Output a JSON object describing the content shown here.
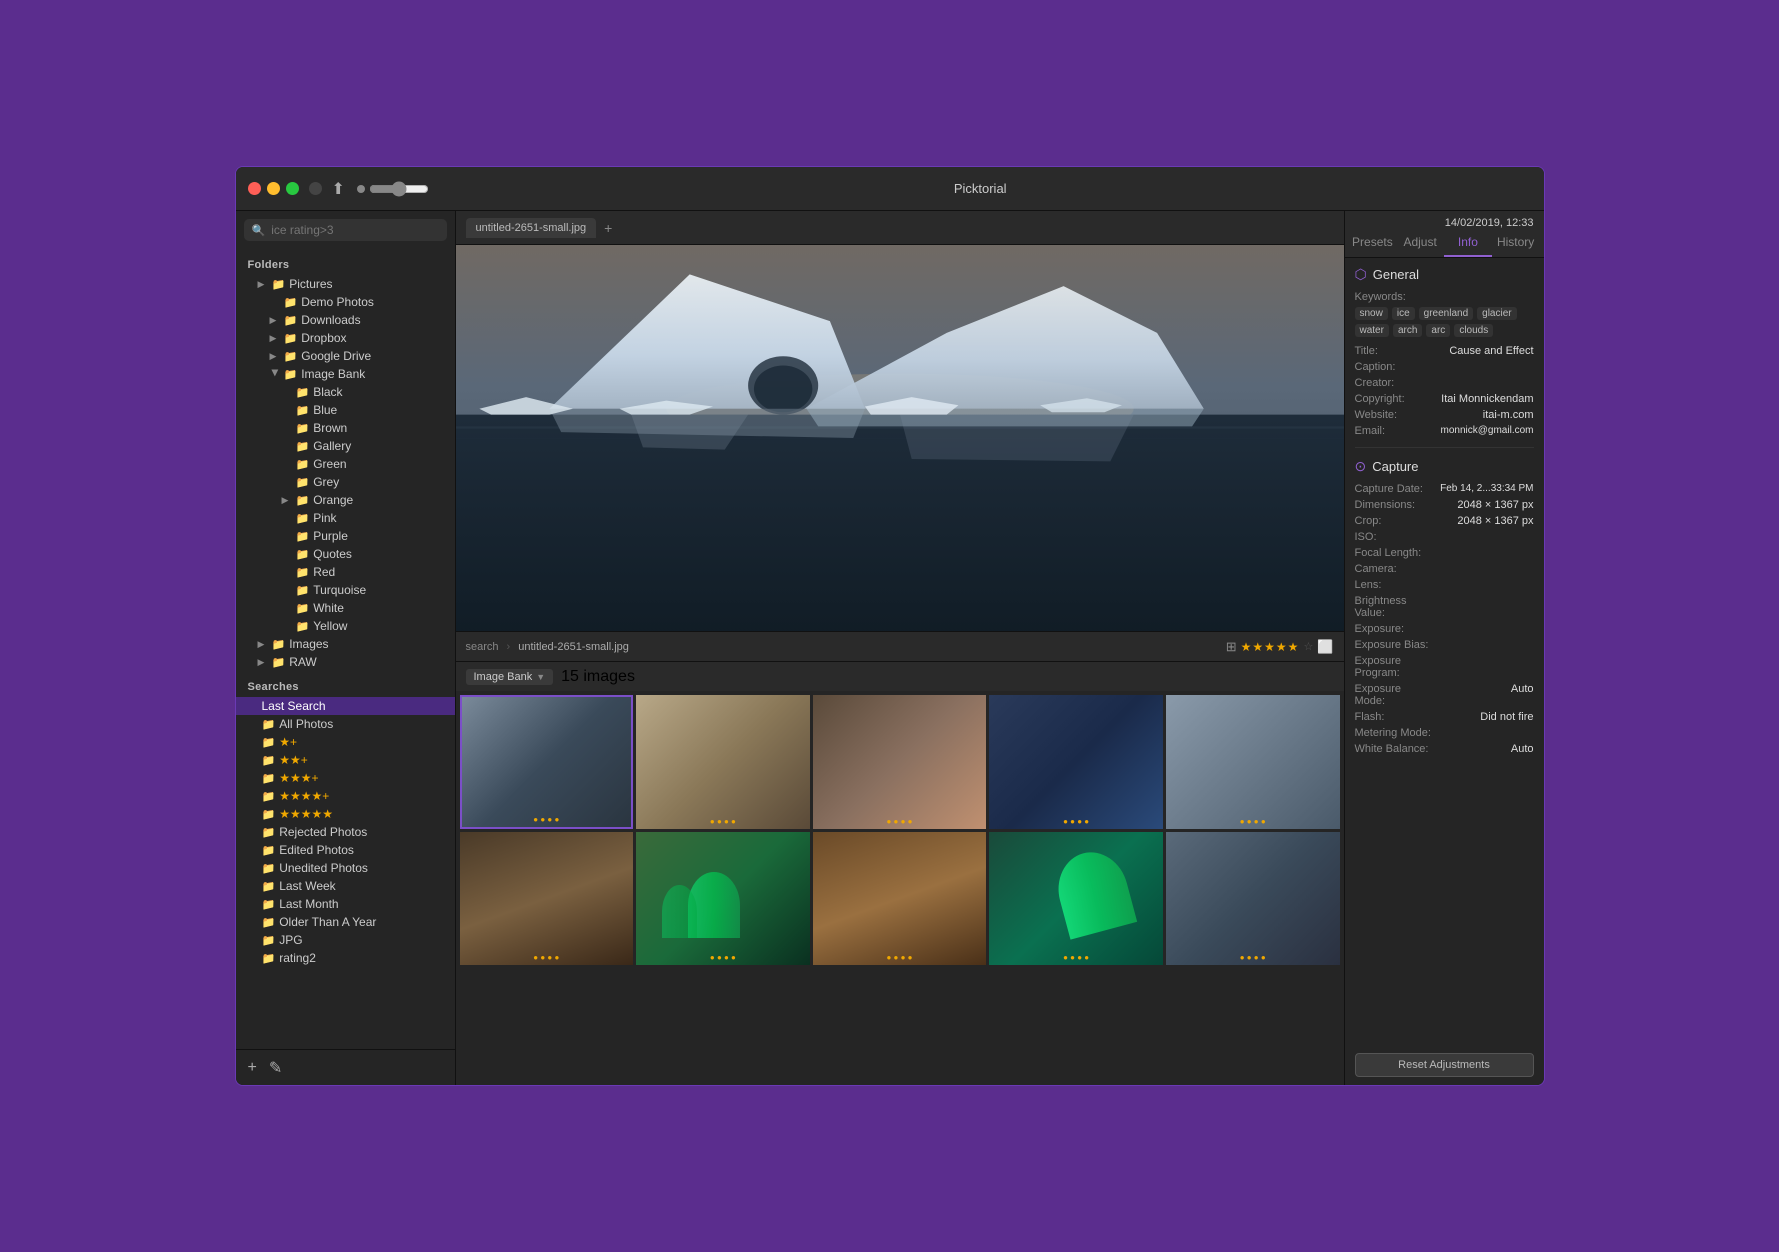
{
  "window": {
    "title": "Picktorial",
    "date": "14/02/2019, 12:33"
  },
  "toolbar": {
    "search_placeholder": "ice rating>3",
    "share_icon": "↑"
  },
  "sidebar": {
    "folders_label": "Folders",
    "searches_label": "Searches",
    "folders": [
      {
        "id": "pictures",
        "label": "Pictures",
        "indent": 1,
        "has_arrow": true,
        "expanded": false
      },
      {
        "id": "demo-photos",
        "label": "Demo Photos",
        "indent": 2,
        "has_arrow": false
      },
      {
        "id": "downloads",
        "label": "Downloads",
        "indent": 2,
        "has_arrow": true
      },
      {
        "id": "dropbox",
        "label": "Dropbox",
        "indent": 2,
        "has_arrow": true
      },
      {
        "id": "google-drive",
        "label": "Google Drive",
        "indent": 2,
        "has_arrow": true
      },
      {
        "id": "image-bank",
        "label": "Image Bank",
        "indent": 2,
        "has_arrow": true,
        "expanded": true
      },
      {
        "id": "black",
        "label": "Black",
        "indent": 3,
        "has_arrow": false
      },
      {
        "id": "blue",
        "label": "Blue",
        "indent": 3,
        "has_arrow": false
      },
      {
        "id": "brown",
        "label": "Brown",
        "indent": 3,
        "has_arrow": false
      },
      {
        "id": "gallery",
        "label": "Gallery",
        "indent": 3,
        "has_arrow": false
      },
      {
        "id": "green",
        "label": "Green",
        "indent": 3,
        "has_arrow": false
      },
      {
        "id": "grey",
        "label": "Grey",
        "indent": 3,
        "has_arrow": false
      },
      {
        "id": "orange",
        "label": "Orange",
        "indent": 3,
        "has_arrow": true
      },
      {
        "id": "pink",
        "label": "Pink",
        "indent": 3,
        "has_arrow": false
      },
      {
        "id": "purple",
        "label": "Purple",
        "indent": 3,
        "has_arrow": false
      },
      {
        "id": "quotes",
        "label": "Quotes",
        "indent": 3,
        "has_arrow": false
      },
      {
        "id": "red",
        "label": "Red",
        "indent": 3,
        "has_arrow": false
      },
      {
        "id": "turquoise",
        "label": "Turquoise",
        "indent": 3,
        "has_arrow": false
      },
      {
        "id": "white",
        "label": "White",
        "indent": 3,
        "has_arrow": false
      },
      {
        "id": "yellow",
        "label": "Yellow",
        "indent": 3,
        "has_arrow": false
      },
      {
        "id": "images",
        "label": "Images",
        "indent": 1,
        "has_arrow": true
      },
      {
        "id": "raw",
        "label": "RAW",
        "indent": 1,
        "has_arrow": true
      }
    ],
    "searches": [
      {
        "id": "last-search",
        "label": "Last Search",
        "active": true
      },
      {
        "id": "all-photos",
        "label": "All Photos"
      },
      {
        "id": "2star",
        "label": "★+"
      },
      {
        "id": "3star",
        "label": "★★+"
      },
      {
        "id": "4star",
        "label": "★★★+"
      },
      {
        "id": "5star",
        "label": "★★★★+"
      },
      {
        "id": "5star-full",
        "label": "★★★★★"
      },
      {
        "id": "rejected",
        "label": "Rejected Photos"
      },
      {
        "id": "edited",
        "label": "Edited Photos"
      },
      {
        "id": "unedited",
        "label": "Unedited Photos"
      },
      {
        "id": "last-week",
        "label": "Last Week"
      },
      {
        "id": "last-month",
        "label": "Last Month"
      },
      {
        "id": "older-year",
        "label": "Older Than A Year"
      },
      {
        "id": "jpg",
        "label": "JPG"
      },
      {
        "id": "rating2",
        "label": "rating2"
      }
    ],
    "footer": {
      "add_label": "+",
      "edit_label": "✎"
    }
  },
  "content": {
    "tab_label": "untitled-2651-small.jpg",
    "breadcrumb": {
      "search": "search",
      "file": "untitled-2651-small.jpg"
    },
    "location": "Image Bank",
    "image_count": "15 images",
    "stars": "★★★★★",
    "star_empty": "☆"
  },
  "thumbnails": [
    {
      "id": 1,
      "color_class": "t1",
      "stars": "• • • •"
    },
    {
      "id": 2,
      "color_class": "t2",
      "stars": "• • • •"
    },
    {
      "id": 3,
      "color_class": "t3",
      "stars": "• • • •"
    },
    {
      "id": 4,
      "color_class": "t4",
      "stars": "• • • •"
    },
    {
      "id": 5,
      "color_class": "t5",
      "stars": "• • • •"
    },
    {
      "id": 6,
      "color_class": "t6",
      "stars": "• • • •"
    },
    {
      "id": 7,
      "color_class": "t7",
      "stars": "• • • •"
    },
    {
      "id": 8,
      "color_class": "t8",
      "stars": "• • • •"
    },
    {
      "id": 9,
      "color_class": "t9",
      "stars": "• • • •"
    },
    {
      "id": 10,
      "color_class": "t10",
      "stars": "• • • •"
    }
  ],
  "right_panel": {
    "date": "14/02/2019, 12:33",
    "tabs": [
      "Presets",
      "Adjust",
      "Info",
      "History"
    ],
    "active_tab": "Info",
    "general": {
      "section_title": "General",
      "keywords_label": "Keywords:",
      "keywords": [
        "snow",
        "ice",
        "greenland",
        "glacier",
        "water",
        "arch",
        "arc",
        "clouds"
      ],
      "title_label": "Title:",
      "title_value": "Cause and  Effect",
      "caption_label": "Caption:",
      "caption_value": "",
      "creator_label": "Creator:",
      "creator_value": "",
      "copyright_label": "Copyright:",
      "copyright_value": "Itai Monnickendam",
      "website_label": "Website:",
      "website_value": "itai-m.com",
      "email_label": "Email:",
      "email_value": "monnick@gmail.com"
    },
    "capture": {
      "section_title": "Capture",
      "capture_date_label": "Capture Date:",
      "capture_date_value": "Feb 14, 2...33:34 PM",
      "dimensions_label": "Dimensions:",
      "dimensions_value": "2048 × 1367 px",
      "crop_label": "Crop:",
      "crop_value": "2048 × 1367 px",
      "iso_label": "ISO:",
      "iso_value": "",
      "focal_label": "Focal Length:",
      "focal_value": "",
      "camera_label": "Camera:",
      "camera_value": "",
      "lens_label": "Lens:",
      "lens_value": "",
      "brightness_label": "Brightness Value:",
      "brightness_value": "",
      "exposure_label": "Exposure:",
      "exposure_value": "",
      "exposure_bias_label": "Exposure Bias:",
      "exposure_bias_value": "",
      "exposure_program_label": "Exposure Program:",
      "exposure_program_value": "",
      "exposure_mode_label": "Exposure Mode:",
      "exposure_mode_value": "Auto",
      "flash_label": "Flash:",
      "flash_value": "Did not fire",
      "metering_label": "Metering Mode:",
      "metering_value": "",
      "white_balance_label": "White Balance:",
      "white_balance_value": "Auto"
    },
    "reset_label": "Reset Adjustments"
  }
}
